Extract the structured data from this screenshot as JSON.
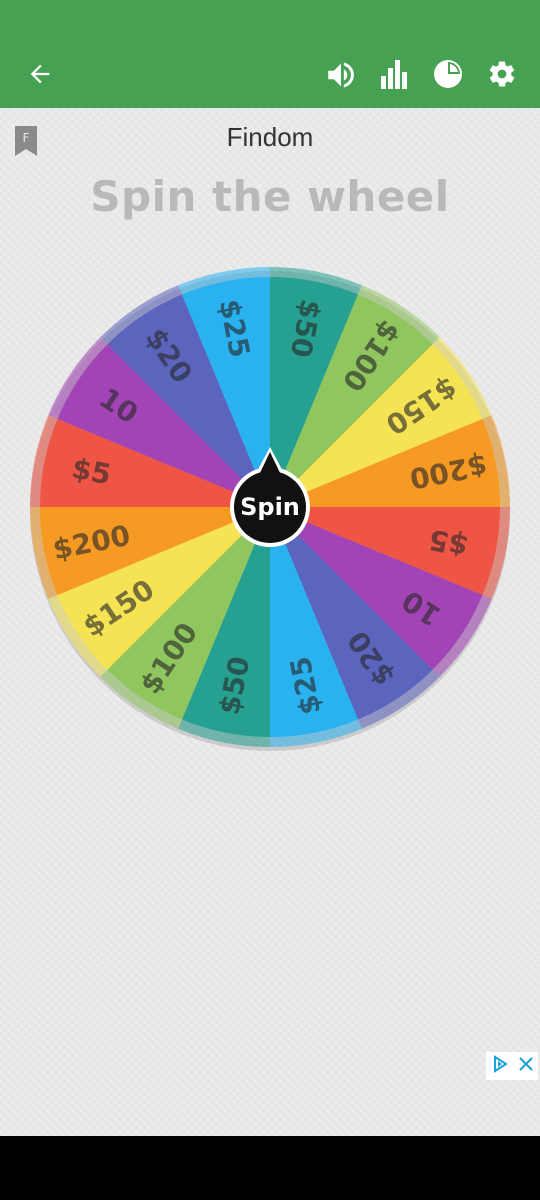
{
  "colors": {
    "appbar": "#46a152",
    "pointer": "#111111"
  },
  "appbar": {
    "icons": [
      "back-arrow-icon",
      "volume-icon",
      "bar-chart-icon",
      "pie-chart-icon",
      "settings-gear-icon"
    ]
  },
  "page": {
    "title": "Findom",
    "subtitle": "Spin the wheel",
    "bookmark_letter": "F"
  },
  "wheel": {
    "spin_label": "Spin",
    "segments": [
      {
        "label": "$50",
        "color": "#26a191"
      },
      {
        "label": "$100",
        "color": "#8fc65e"
      },
      {
        "label": "$150",
        "color": "#f5e354"
      },
      {
        "label": "$200",
        "color": "#f69a23"
      },
      {
        "label": "$5",
        "color": "#ee5545"
      },
      {
        "label": "10",
        "color": "#a244b6"
      },
      {
        "label": "$20",
        "color": "#5b65be"
      },
      {
        "label": "$25",
        "color": "#29b1f0"
      },
      {
        "label": "$50",
        "color": "#26a191"
      },
      {
        "label": "$100",
        "color": "#8fc65e"
      },
      {
        "label": "$150",
        "color": "#f5e354"
      },
      {
        "label": "$200",
        "color": "#f69a23"
      },
      {
        "label": "$5",
        "color": "#ee5545"
      },
      {
        "label": "10",
        "color": "#a244b6"
      },
      {
        "label": "$20",
        "color": "#5b65be"
      },
      {
        "label": "$25",
        "color": "#29b1f0"
      }
    ]
  },
  "ad": {
    "icons": [
      "adchoices-icon",
      "close-icon"
    ]
  }
}
